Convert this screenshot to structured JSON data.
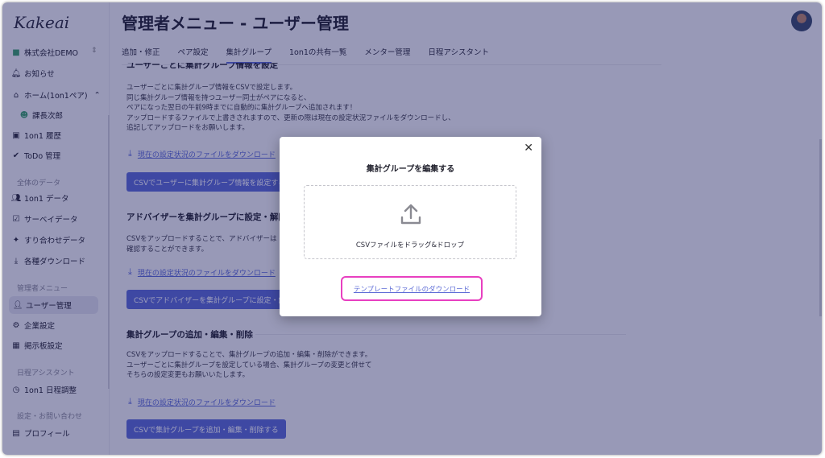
{
  "app": {
    "logo": "Kakeai"
  },
  "sidebar": {
    "company": "株式会社DEMO",
    "items": [
      {
        "label": "お知らせ",
        "icon": "bell-icon"
      },
      {
        "label": "ホーム(1on1ペア)",
        "icon": "home-icon"
      },
      {
        "label": "課長次郎",
        "icon": "user-circle-icon"
      },
      {
        "label": "1on1 履歴",
        "icon": "history-icon"
      },
      {
        "label": "ToDo 管理",
        "icon": "check-circle-icon"
      },
      {
        "label": "1on1 データ",
        "icon": "people-icon"
      },
      {
        "label": "サーベイデータ",
        "icon": "survey-icon"
      },
      {
        "label": "すり合わせデータ",
        "icon": "handshake-icon"
      },
      {
        "label": "各種ダウンロード",
        "icon": "download-icon"
      },
      {
        "label": "ユーザー管理",
        "icon": "user-manage-icon"
      },
      {
        "label": "企業設定",
        "icon": "company-settings-icon"
      },
      {
        "label": "掲示板設定",
        "icon": "board-icon"
      },
      {
        "label": "1on1 日程調整",
        "icon": "clock-icon"
      },
      {
        "label": "プロフィール",
        "icon": "profile-icon"
      }
    ],
    "sections": {
      "all_data": "全体のデータ",
      "admin": "管理者メニュー",
      "schedule": "日程アシスタント",
      "settings": "設定・お問い合わせ"
    }
  },
  "header": {
    "title": "管理者メニュー - ユーザー管理"
  },
  "tabs": [
    "追加・修正",
    "ペア設定",
    "集計グループ",
    "1on1の共有一覧",
    "メンター管理",
    "日程アシスタント"
  ],
  "main": {
    "section1": {
      "heading": "ユーザーごとに集計グループ情報を設定",
      "body": [
        "ユーザーごとに集計グループ情報をCSVで設定します。",
        "同じ集計グループ情報を持つユーザー同士がペアになると、",
        "ペアになった翌日の午前9時までに自動的に集計グループへ追加されます！",
        "アップロードするファイルで上書きされますので、更新の際は現在の設定状況ファイルをダウンロードし、",
        "追記してアップロードをお願いします。"
      ],
      "download": "現在の設定状況のファイルをダウンロード",
      "button": "CSVでユーザーに集計グループ情報を設定する"
    },
    "section2": {
      "heading": "アドバイザーを集計グループに設定・解除",
      "body": [
        "CSVをアップロードすることで、アドバイザーは",
        "確認することができます。"
      ],
      "download": "現在の設定状況のファイルをダウンロード",
      "button": "CSVでアドバイザーを集計グループに設定・解"
    },
    "section3": {
      "heading": "集計グループの追加・編集・削除",
      "body": [
        "CSVをアップロードすることで、集計グループの追加・編集・削除ができます。",
        "ユーザーごとに集計グループを設定している場合、集計グループの変更と併せて",
        "そちらの設定変更もお願いいたします。"
      ],
      "download": "現在の設定状況のファイルをダウンロード",
      "button": "CSVで集計グループを追加・編集・削除する"
    }
  },
  "modal": {
    "title": "集計グループを編集する",
    "dropzone": "CSVファイルをドラッグ&ドロップ",
    "template_link": "テンプレートファイルのダウンロード"
  },
  "colors": {
    "accent": "#5c6bd6",
    "highlight": "#e83fc0",
    "overlay": "#16185c"
  }
}
